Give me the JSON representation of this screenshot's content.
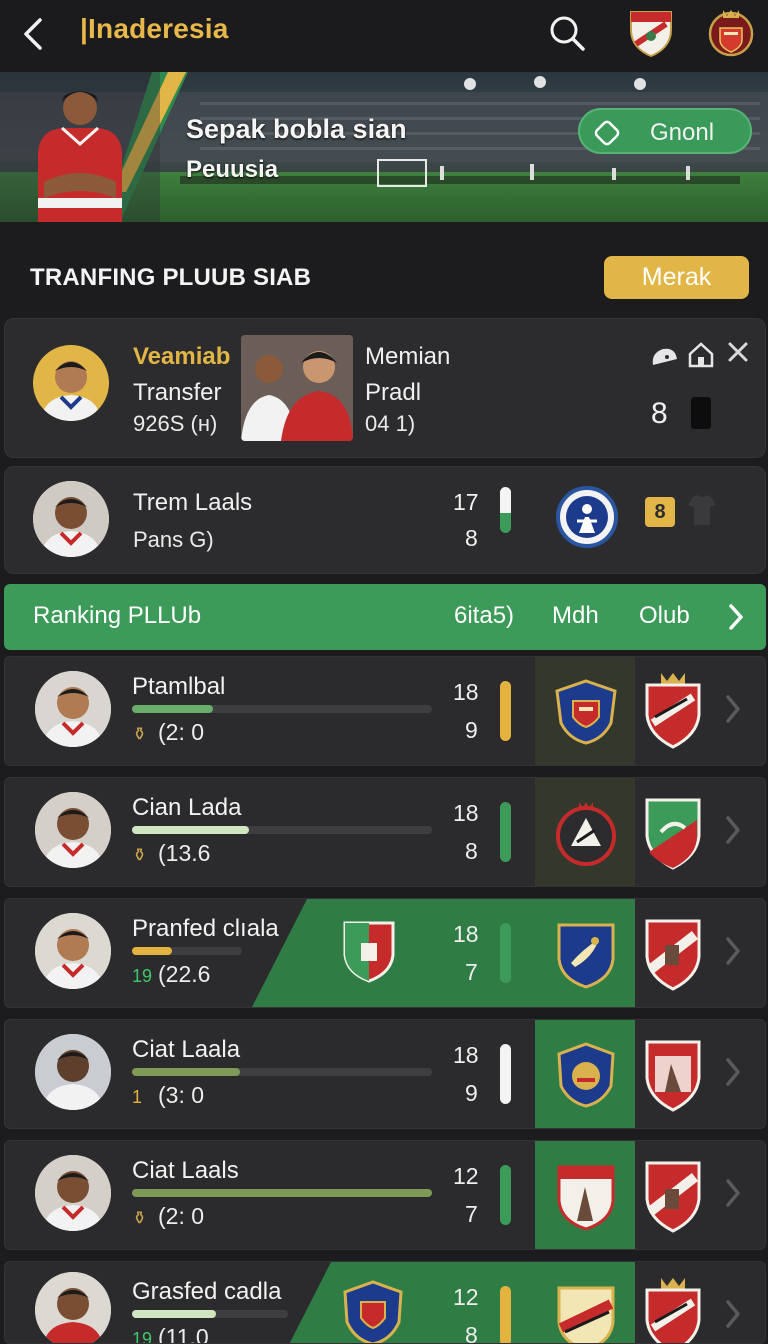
{
  "header": {
    "title": "|Inaderesia",
    "back_icon": "back-arrow-icon",
    "search_icon": "search-icon"
  },
  "banner": {
    "line1": "Sepak bobla  sian",
    "line2": "Peuusia",
    "button_label": "Gnonl"
  },
  "section": {
    "title": "TRANFING PLUUB SIAB",
    "action_label": "Merak"
  },
  "featured": {
    "name": "Veamiab",
    "line2": "Transfer",
    "line3": "926S (н)",
    "col2_line1": "Memian",
    "col2_line2": "Pradl",
    "col2_line3": "04  1)",
    "count": "8"
  },
  "second": {
    "name": "Trem Laals",
    "sub": "Pans G)",
    "n1": "17",
    "n2": "8"
  },
  "ranking": {
    "title": "Ranking PLLUb",
    "col1": "6ita5)",
    "col2": "Mdh",
    "col3": "Olub"
  },
  "rows": [
    {
      "name": "Ptamlbal",
      "pre": "⚱",
      "sub": "(2: 0",
      "n1": "18",
      "n2": "9",
      "progress": 0.27,
      "fill": "#69ad6a",
      "bar": "#e4b23f",
      "pre_color": "#c9a24b"
    },
    {
      "name": "Cian Lada",
      "pre": "⚱",
      "sub": "(13.6",
      "n1": "18",
      "n2": "8",
      "progress": 0.39,
      "fill": "#cfe6bf",
      "bar": "#3d9b59",
      "pre_color": "#c9a24b"
    },
    {
      "name": "Pranfed clıala",
      "pre": "19",
      "sub": "(22.6",
      "n1": "18",
      "n2": "7",
      "progress": 0.36,
      "fill": "#e4b23f",
      "bar": "#3d9b59",
      "pre_color": "#3ec76a"
    },
    {
      "name": "Ciat Laala",
      "pre": "1",
      "sub": "(3: 0",
      "n1": "18",
      "n2": "9",
      "progress": 0.36,
      "fill": "#7f9a57",
      "bar": "#f4f4f4",
      "pre_color": "#e4b23f"
    },
    {
      "name": "Ciat Laals",
      "pre": "⚱",
      "sub": "(2: 0",
      "n1": "12",
      "n2": "7",
      "progress": 1.0,
      "fill": "#7f9a57",
      "bar": "#3d9b59",
      "pre_color": "#c9a24b"
    },
    {
      "name": "Grasfed cadla",
      "pre": "19",
      "sub": "(11.0",
      "n1": "12",
      "n2": "8",
      "progress": 0.54,
      "fill": "#cfe6bf",
      "bar": "#e4b23f",
      "pre_color": "#3ec76a"
    }
  ],
  "colors": {
    "accent_green": "#3d9b59",
    "accent_gold": "#e2b646",
    "bg": "#1c1c1e",
    "card": "#2c2c2e"
  }
}
